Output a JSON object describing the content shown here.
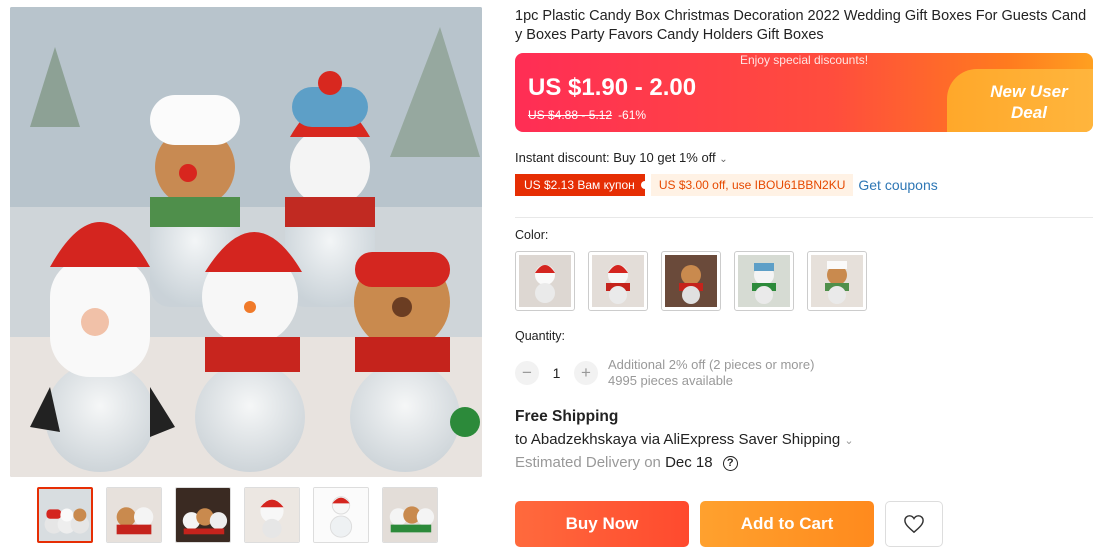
{
  "product": {
    "title": "1pc Plastic Candy Box Christmas Decoration 2022 Wedding Gift Boxes For Guests Candy Boxes Party Favors Candy Holders Gift Boxes"
  },
  "gallery": {
    "main_image_icon": "christmas-candy-jars-photo",
    "thumbnails": [
      "thumb-1",
      "thumb-2",
      "thumb-3",
      "thumb-4",
      "thumb-5",
      "thumb-6"
    ]
  },
  "price": {
    "banner": "Enjoy special discounts!",
    "current": "US $1.90 - 2.00",
    "original": "US $4.88 - 5.12",
    "discount": "-61%",
    "new_user_deal": "New User Deal"
  },
  "discounts": {
    "instant": "Instant discount: Buy 10 get 1% off",
    "coupon_red": "US $2.13 Вам купон",
    "coupon_orange": "US $3.00 off, use IBOU61BBN2KU",
    "get_coupons": "Get coupons"
  },
  "color": {
    "label": "Color:",
    "options": [
      "color-1",
      "color-2",
      "color-3",
      "color-4",
      "color-5"
    ]
  },
  "quantity": {
    "label": "Quantity:",
    "minus": "−",
    "value": "1",
    "plus": "+",
    "note_line1": "Additional 2% off (2 pieces or more)",
    "note_line2": "4995 pieces available"
  },
  "shipping": {
    "title": "Free Shipping",
    "line": "to Abadzekhskaya via AliExpress Saver Shipping",
    "estimated_label": "Estimated Delivery on",
    "date": "Dec 18",
    "help_symbol": "?"
  },
  "actions": {
    "buy_now": "Buy Now",
    "add_to_cart": "Add to Cart",
    "wishlist_icon": "heart-icon"
  },
  "colors": {
    "accent_red": "#e62e04",
    "link_blue": "#2e77b5",
    "buy_button": "#ff5a34",
    "cart_button": "#ff9a24"
  }
}
